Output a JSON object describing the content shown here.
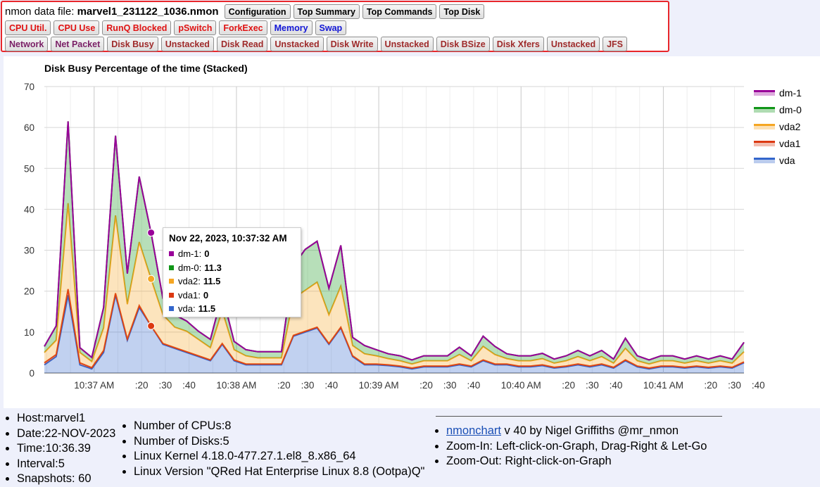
{
  "header": {
    "file_prefix": "nmon data file:",
    "file_name": "marvel1_231122_1036.nmon",
    "row1_buttons": [
      {
        "label": "Configuration",
        "color": "black"
      },
      {
        "label": "Top Summary",
        "color": "black"
      },
      {
        "label": "Top Commands",
        "color": "black"
      },
      {
        "label": "Top Disk",
        "color": "black"
      }
    ],
    "row2_buttons": [
      {
        "label": "CPU Util.",
        "color": "red"
      },
      {
        "label": "CPU Use",
        "color": "red"
      },
      {
        "label": "RunQ Blocked",
        "color": "red"
      },
      {
        "label": "pSwitch",
        "color": "red"
      },
      {
        "label": "ForkExec",
        "color": "red"
      },
      {
        "label": "Memory",
        "color": "blue"
      },
      {
        "label": "Swap",
        "color": "blue"
      }
    ],
    "row3_buttons": [
      {
        "label": "Network",
        "color": "purple"
      },
      {
        "label": "Net Packet",
        "color": "purple"
      },
      {
        "label": "Disk Busy",
        "color": "maroon"
      },
      {
        "label": "Unstacked",
        "color": "maroon"
      },
      {
        "label": "Disk Read",
        "color": "maroon"
      },
      {
        "label": "Unstacked",
        "color": "maroon"
      },
      {
        "label": "Disk Write",
        "color": "maroon"
      },
      {
        "label": "Unstacked",
        "color": "maroon"
      },
      {
        "label": "Disk BSize",
        "color": "maroon"
      },
      {
        "label": "Disk Xfers",
        "color": "maroon"
      },
      {
        "label": "Unstacked",
        "color": "maroon"
      },
      {
        "label": "JFS",
        "color": "maroon"
      }
    ]
  },
  "chart_data": {
    "type": "area",
    "stacked": true,
    "title": "Disk Busy Percentage of the time (Stacked)",
    "ylim": [
      0,
      70
    ],
    "yticks": [
      0,
      10,
      20,
      30,
      40,
      50,
      60,
      70
    ],
    "x_start": "10:36:39",
    "interval_seconds": 5,
    "x_tick_labels": [
      {
        "seconds": 21,
        "label": "10:37 AM"
      },
      {
        "seconds": 41,
        "label": ":20"
      },
      {
        "seconds": 51,
        "label": ":30"
      },
      {
        "seconds": 61,
        "label": ":40"
      },
      {
        "seconds": 81,
        "label": "10:38 AM"
      },
      {
        "seconds": 101,
        "label": ":20"
      },
      {
        "seconds": 111,
        "label": ":30"
      },
      {
        "seconds": 121,
        "label": ":40"
      },
      {
        "seconds": 141,
        "label": "10:39 AM"
      },
      {
        "seconds": 161,
        "label": ":20"
      },
      {
        "seconds": 171,
        "label": ":30"
      },
      {
        "seconds": 181,
        "label": ":40"
      },
      {
        "seconds": 201,
        "label": "10:40 AM"
      },
      {
        "seconds": 221,
        "label": ":20"
      },
      {
        "seconds": 231,
        "label": ":30"
      },
      {
        "seconds": 241,
        "label": ":40"
      },
      {
        "seconds": 261,
        "label": "10:41 AM"
      },
      {
        "seconds": 281,
        "label": ":20"
      },
      {
        "seconds": 291,
        "label": ":30"
      },
      {
        "seconds": 301,
        "label": ":40"
      }
    ],
    "legend_position": "right",
    "series": [
      {
        "name": "vda",
        "color": "#3366cc",
        "values": [
          2,
          4,
          19,
          2,
          1,
          5,
          19,
          8,
          16,
          11.5,
          7,
          6,
          5,
          4,
          3,
          7,
          3,
          2,
          2,
          2,
          2,
          9,
          10,
          11,
          7,
          11,
          4,
          2,
          2,
          1.8,
          1.5,
          1,
          1.5,
          1.5,
          1.5,
          2,
          1.5,
          3,
          2,
          2,
          1.5,
          1.5,
          1.8,
          1.2,
          1.5,
          2,
          1.5,
          2,
          1.2,
          3,
          1.5,
          1,
          1.5,
          1.5,
          1.2,
          1.5,
          1.2,
          1.5,
          1.2,
          2.5
        ]
      },
      {
        "name": "vda1",
        "color": "#dc3912",
        "values": [
          0.5,
          0.5,
          1.5,
          0.5,
          0.3,
          0.5,
          0.5,
          0.3,
          0.5,
          0,
          0.2,
          0.2,
          0.2,
          0.2,
          0.2,
          0.2,
          0.2,
          0.2,
          0.2,
          0.2,
          0.2,
          0.2,
          0.2,
          0.2,
          0.2,
          0.2,
          0.2,
          0.2,
          0.2,
          0.2,
          0.2,
          0.2,
          0.2,
          0.2,
          0.2,
          0.2,
          0.2,
          0.2,
          0.2,
          0.2,
          0.2,
          0.2,
          0.2,
          0.2,
          0.2,
          0.2,
          0.2,
          0.2,
          0.2,
          0.2,
          0.2,
          0.2,
          0.2,
          0.2,
          0.2,
          0.2,
          0.2,
          0.2,
          0.2,
          0.2
        ]
      },
      {
        "name": "vda2",
        "color": "#f5a623",
        "values": [
          2.5,
          3.5,
          21,
          2.5,
          1.5,
          5.5,
          19,
          8.5,
          15.5,
          11.5,
          7,
          5,
          5,
          4,
          3,
          8,
          2.5,
          2,
          1.5,
          1.5,
          1.5,
          9,
          10,
          11,
          7,
          10,
          2.5,
          2.5,
          2,
          1.5,
          1.3,
          1,
          1.3,
          1.3,
          1.3,
          2.3,
          1.3,
          3.3,
          2.3,
          1.3,
          1.3,
          1.3,
          1.5,
          1,
          1.3,
          1.8,
          1.3,
          1.8,
          1,
          2.8,
          1.3,
          1,
          1.3,
          1.3,
          1,
          1.3,
          1,
          1.3,
          1,
          2.5
        ]
      },
      {
        "name": "dm-0",
        "color": "#109618",
        "values": [
          1.5,
          3.5,
          20,
          1.2,
          1,
          5,
          19.5,
          7.5,
          16,
          11.3,
          4,
          3,
          2.5,
          2,
          2,
          4,
          2,
          1.5,
          1.5,
          1.5,
          1.5,
          8,
          10,
          10,
          6.5,
          10,
          2,
          2,
          1.5,
          1.2,
          1.2,
          1,
          1.2,
          1.2,
          1.2,
          1.8,
          1.2,
          2.5,
          2,
          1.2,
          1.2,
          1.2,
          1.3,
          1,
          1.2,
          1.5,
          1.2,
          1.5,
          1,
          2.5,
          1.2,
          1,
          1.2,
          1.2,
          1,
          1.2,
          1,
          1.2,
          1,
          2.3
        ]
      },
      {
        "name": "dm-1",
        "color": "#990099",
        "values": [
          0,
          0,
          0,
          0,
          0,
          0,
          0,
          0,
          0,
          0,
          0,
          0,
          0,
          0,
          0,
          0,
          0,
          0,
          0,
          0,
          0,
          0,
          0,
          0,
          0,
          0,
          0,
          0,
          0,
          0,
          0,
          0,
          0,
          0,
          0,
          0,
          0,
          0,
          0,
          0,
          0,
          0,
          0,
          0,
          0,
          0,
          0,
          0,
          0,
          0,
          0,
          0,
          0,
          0,
          0,
          0,
          0,
          0,
          0,
          0
        ]
      }
    ]
  },
  "tooltip": {
    "date": "Nov 22, 2023, 10:37:32 AM",
    "rows": [
      {
        "name": "dm-1:",
        "value": "0",
        "color": "#990099"
      },
      {
        "name": "dm-0:",
        "value": "11.3",
        "color": "#109618"
      },
      {
        "name": "vda2:",
        "value": "11.5",
        "color": "#f5a623"
      },
      {
        "name": "vda1:",
        "value": "0",
        "color": "#dc3912"
      },
      {
        "name": "vda:",
        "value": "11.5",
        "color": "#3366cc"
      }
    ]
  },
  "footer": {
    "col1": [
      "Host:marvel1",
      "Date:22-NOV-2023",
      "Time:10:36.39",
      "Interval:5",
      "Snapshots: 60"
    ],
    "col2": [
      "Number of CPUs:8",
      "Number of Disks:5",
      "Linux Kernel 4.18.0-477.27.1.el8_8.x86_64",
      "Linux Version \"QRed Hat Enterprise Linux 8.8 (Ootpa)Q\""
    ],
    "link_label": "nmonchart",
    "link_suffix": " v 40 by Nigel Griffiths @mr_nmon",
    "col3": [
      "Zoom-In: Left-click-on-Graph, Drag-Right & Let-Go",
      "Zoom-Out: Right-click-on-Graph"
    ]
  }
}
